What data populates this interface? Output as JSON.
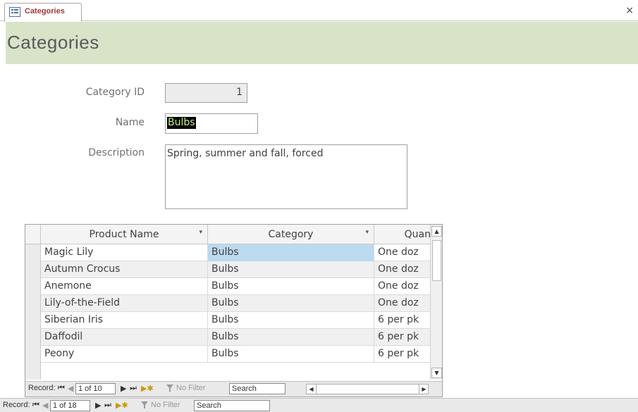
{
  "window": {
    "tab_label": "Categories",
    "close_glyph": "×"
  },
  "header": {
    "title": "Categories"
  },
  "form": {
    "category_id": {
      "label": "Category ID",
      "value": "1"
    },
    "name": {
      "label": "Name",
      "value": "Bulbs"
    },
    "description": {
      "label": "Description",
      "value": "Spring, summer and fall, forced"
    }
  },
  "datasheet": {
    "columns": [
      {
        "label": "Product Name",
        "sort_glyph": "▾"
      },
      {
        "label": "Category",
        "sort_glyph": "▾"
      },
      {
        "label": "Quan"
      }
    ],
    "rows": [
      {
        "product": "Magic Lily",
        "category": "Bulbs",
        "quantity": "One doz"
      },
      {
        "product": "Autumn Crocus",
        "category": "Bulbs",
        "quantity": "One doz"
      },
      {
        "product": "Anemone",
        "category": "Bulbs",
        "quantity": "One doz"
      },
      {
        "product": "Lily-of-the-Field",
        "category": "Bulbs",
        "quantity": "One doz"
      },
      {
        "product": "Siberian Iris",
        "category": "Bulbs",
        "quantity": "6 per pk"
      },
      {
        "product": "Daffodil",
        "category": "Bulbs",
        "quantity": "6 per pk"
      },
      {
        "product": "Peony",
        "category": "Bulbs",
        "quantity": "6 per pk"
      }
    ],
    "nav": {
      "record_label": "Record:",
      "first": "⏮",
      "prev": "◀",
      "next": "▶",
      "last": "⏭",
      "new": "▶✱",
      "position": "1 of 10",
      "filter_label": "No Filter",
      "search_placeholder": "Search"
    }
  },
  "form_nav": {
    "record_label": "Record:",
    "position": "1 of 18",
    "filter_label": "No Filter",
    "search_placeholder": "Search"
  },
  "colors": {
    "header_bg": "#d8e3c8",
    "selection": "#bcdaf0",
    "tab_label": "#a33a3a"
  }
}
